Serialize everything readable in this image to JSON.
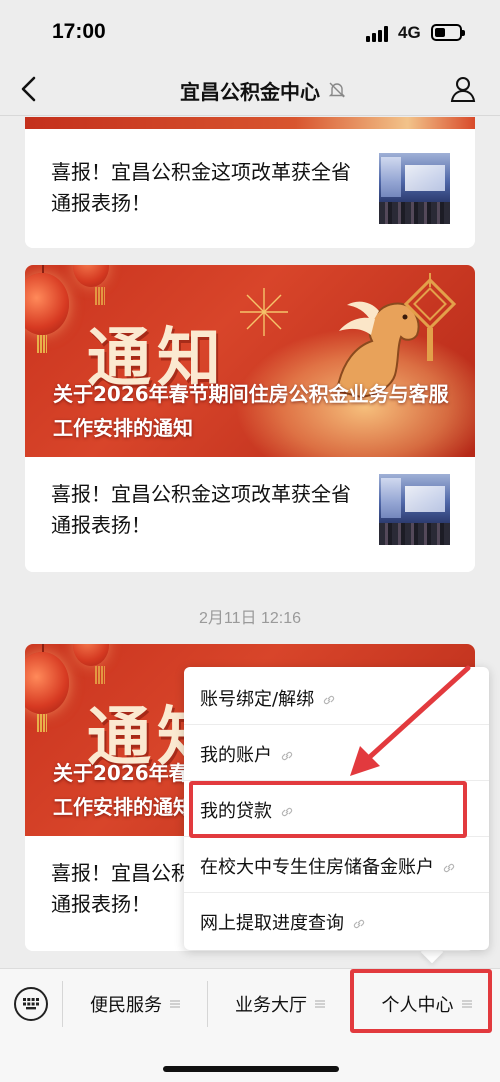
{
  "status_bar": {
    "time": "17:00",
    "network": "4G"
  },
  "nav": {
    "title": "宜昌公积金中心"
  },
  "feed": {
    "article_items": [
      {
        "title": "喜报！宜昌公积金这项改革获全省通报表扬！"
      },
      {
        "title": "喜报！宜昌公积金这项改革获全省通报表扬！"
      },
      {
        "title": "喜报！宜昌公积金这项改革获全省通报表扬！"
      }
    ],
    "banners": [
      {
        "headline": "通知",
        "title": "关于2026年春节期间住房公积金业务与客服工作安排的通知"
      },
      {
        "headline": "通知",
        "title": "关于2026年春节期间住房公积金业务与客服工作安排的通知"
      }
    ],
    "date": "2月11日 12:16"
  },
  "popup_menu": {
    "items": [
      {
        "label": "账号绑定/解绑"
      },
      {
        "label": "我的账户"
      },
      {
        "label": "我的贷款"
      },
      {
        "label": "在校大中专生住房储备金账户"
      },
      {
        "label": "网上提取进度查询"
      }
    ],
    "highlighted_index": 2
  },
  "bottom_menu": {
    "tabs": [
      {
        "label": "便民服务"
      },
      {
        "label": "业务大厅"
      },
      {
        "label": "个人中心"
      }
    ]
  },
  "colors": {
    "annotation_red": "#e23a3e",
    "banner_red": "#c9331e"
  }
}
